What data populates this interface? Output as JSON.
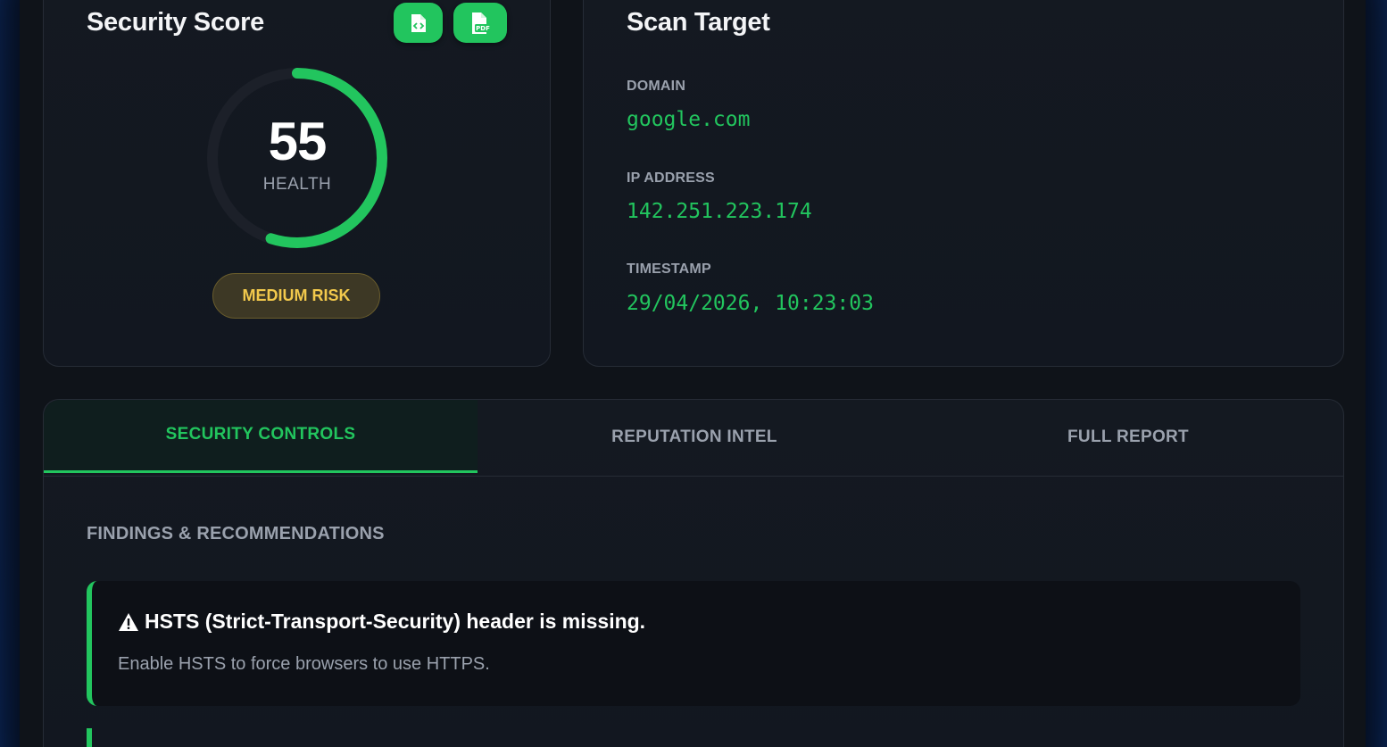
{
  "score_card": {
    "title": "Security Score",
    "export_code_icon": "code-file-icon",
    "export_pdf_icon": "pdf-file-icon",
    "score": "55",
    "score_fraction": 0.55,
    "score_label": "HEALTH",
    "risk_label": "MEDIUM RISK"
  },
  "target_card": {
    "title": "Scan Target",
    "domain_label": "DOMAIN",
    "domain_value": "google.com",
    "ip_label": "IP ADDRESS",
    "ip_value": "142.251.223.174",
    "timestamp_label": "TIMESTAMP",
    "timestamp_value": "29/04/2026, 10:23:03"
  },
  "tabs": [
    {
      "label": "SECURITY CONTROLS",
      "active": true
    },
    {
      "label": "REPUTATION INTEL",
      "active": false
    },
    {
      "label": "FULL REPORT",
      "active": false
    }
  ],
  "findings": {
    "heading": "FINDINGS & RECOMMENDATIONS",
    "items": [
      {
        "icon": "warning-icon",
        "title": "HSTS (Strict-Transport-Security) header is missing.",
        "recommendation": "Enable HSTS to force browsers to use HTTPS."
      }
    ]
  },
  "colors": {
    "accent": "#22c55e",
    "risk_medium": "#f2c94c",
    "background": "#0f1319"
  }
}
